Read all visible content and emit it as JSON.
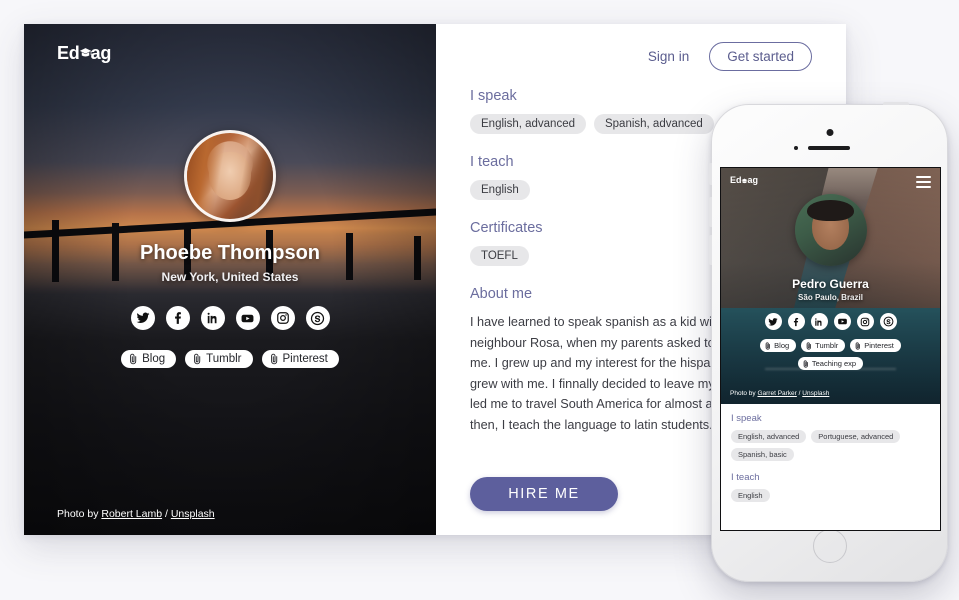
{
  "brand": {
    "name": "EduTag",
    "name_part1": "Ed",
    "name_part2": "ag",
    "cap_icon": "graduation-cap-icon"
  },
  "desktop": {
    "nav": {
      "signin_label": "Sign in",
      "get_started_label": "Get started"
    },
    "profile": {
      "name": "Phoebe Thompson",
      "location": "New York, United States"
    },
    "social": [
      {
        "name": "twitter-icon",
        "label": "Twitter"
      },
      {
        "name": "facebook-icon",
        "label": "Facebook"
      },
      {
        "name": "linkedin-icon",
        "label": "LinkedIn"
      },
      {
        "name": "youtube-icon",
        "label": "YouTube"
      },
      {
        "name": "instagram-icon",
        "label": "Instagram"
      },
      {
        "name": "skype-icon",
        "label": "Skype"
      }
    ],
    "link_pills": [
      "Blog",
      "Tumblr",
      "Pinterest"
    ],
    "photo_credit": {
      "prefix": "Photo by ",
      "author": "Robert Lamb",
      "separator": " / ",
      "source": "Unsplash"
    },
    "sections": {
      "speak": {
        "title": "I speak",
        "tags": [
          "English, advanced",
          "Spanish, advanced"
        ]
      },
      "teach": {
        "title": "I teach",
        "tags": [
          "English"
        ]
      },
      "certificates": {
        "title": "Certificates",
        "tags": [
          "TOEFL"
        ]
      },
      "about": {
        "title": "About me",
        "text": "I have learned to speak spanish as a kid with my neighbour Rosa, when my parents asked to watch over me. I grew up and my interest for the hispanic culture only grew with me. I finnally decided to leave my house, which led me to travel South America for almost a year. Since then, I teach the language to latin students."
      }
    },
    "hire_button_label": "HIRE ME"
  },
  "mobile": {
    "menu_icon": "hamburger-menu-icon",
    "profile": {
      "name": "Pedro Guerra",
      "location": "São Paulo, Brazil"
    },
    "social": [
      {
        "name": "twitter-icon",
        "label": "Twitter"
      },
      {
        "name": "facebook-icon",
        "label": "Facebook"
      },
      {
        "name": "linkedin-icon",
        "label": "LinkedIn"
      },
      {
        "name": "youtube-icon",
        "label": "YouTube"
      },
      {
        "name": "instagram-icon",
        "label": "Instagram"
      },
      {
        "name": "skype-icon",
        "label": "Skype"
      }
    ],
    "link_pills": [
      "Blog",
      "Tumblr",
      "Pinterest",
      "Teaching exp"
    ],
    "photo_credit": {
      "prefix": "Photo by ",
      "author": "Garret Parker",
      "separator": " / ",
      "source": "Unsplash"
    },
    "sections": {
      "speak": {
        "title": "I speak",
        "tags": [
          "English, advanced",
          "Portuguese, advanced",
          "Spanish, basic"
        ]
      },
      "teach": {
        "title": "I teach",
        "tags": [
          "English"
        ]
      }
    }
  },
  "colors": {
    "accent": "#5d5f9d",
    "section_title": "#6b6d9e",
    "tag_bg": "#e7e7e9",
    "page_bg": "#f7f7fa"
  }
}
